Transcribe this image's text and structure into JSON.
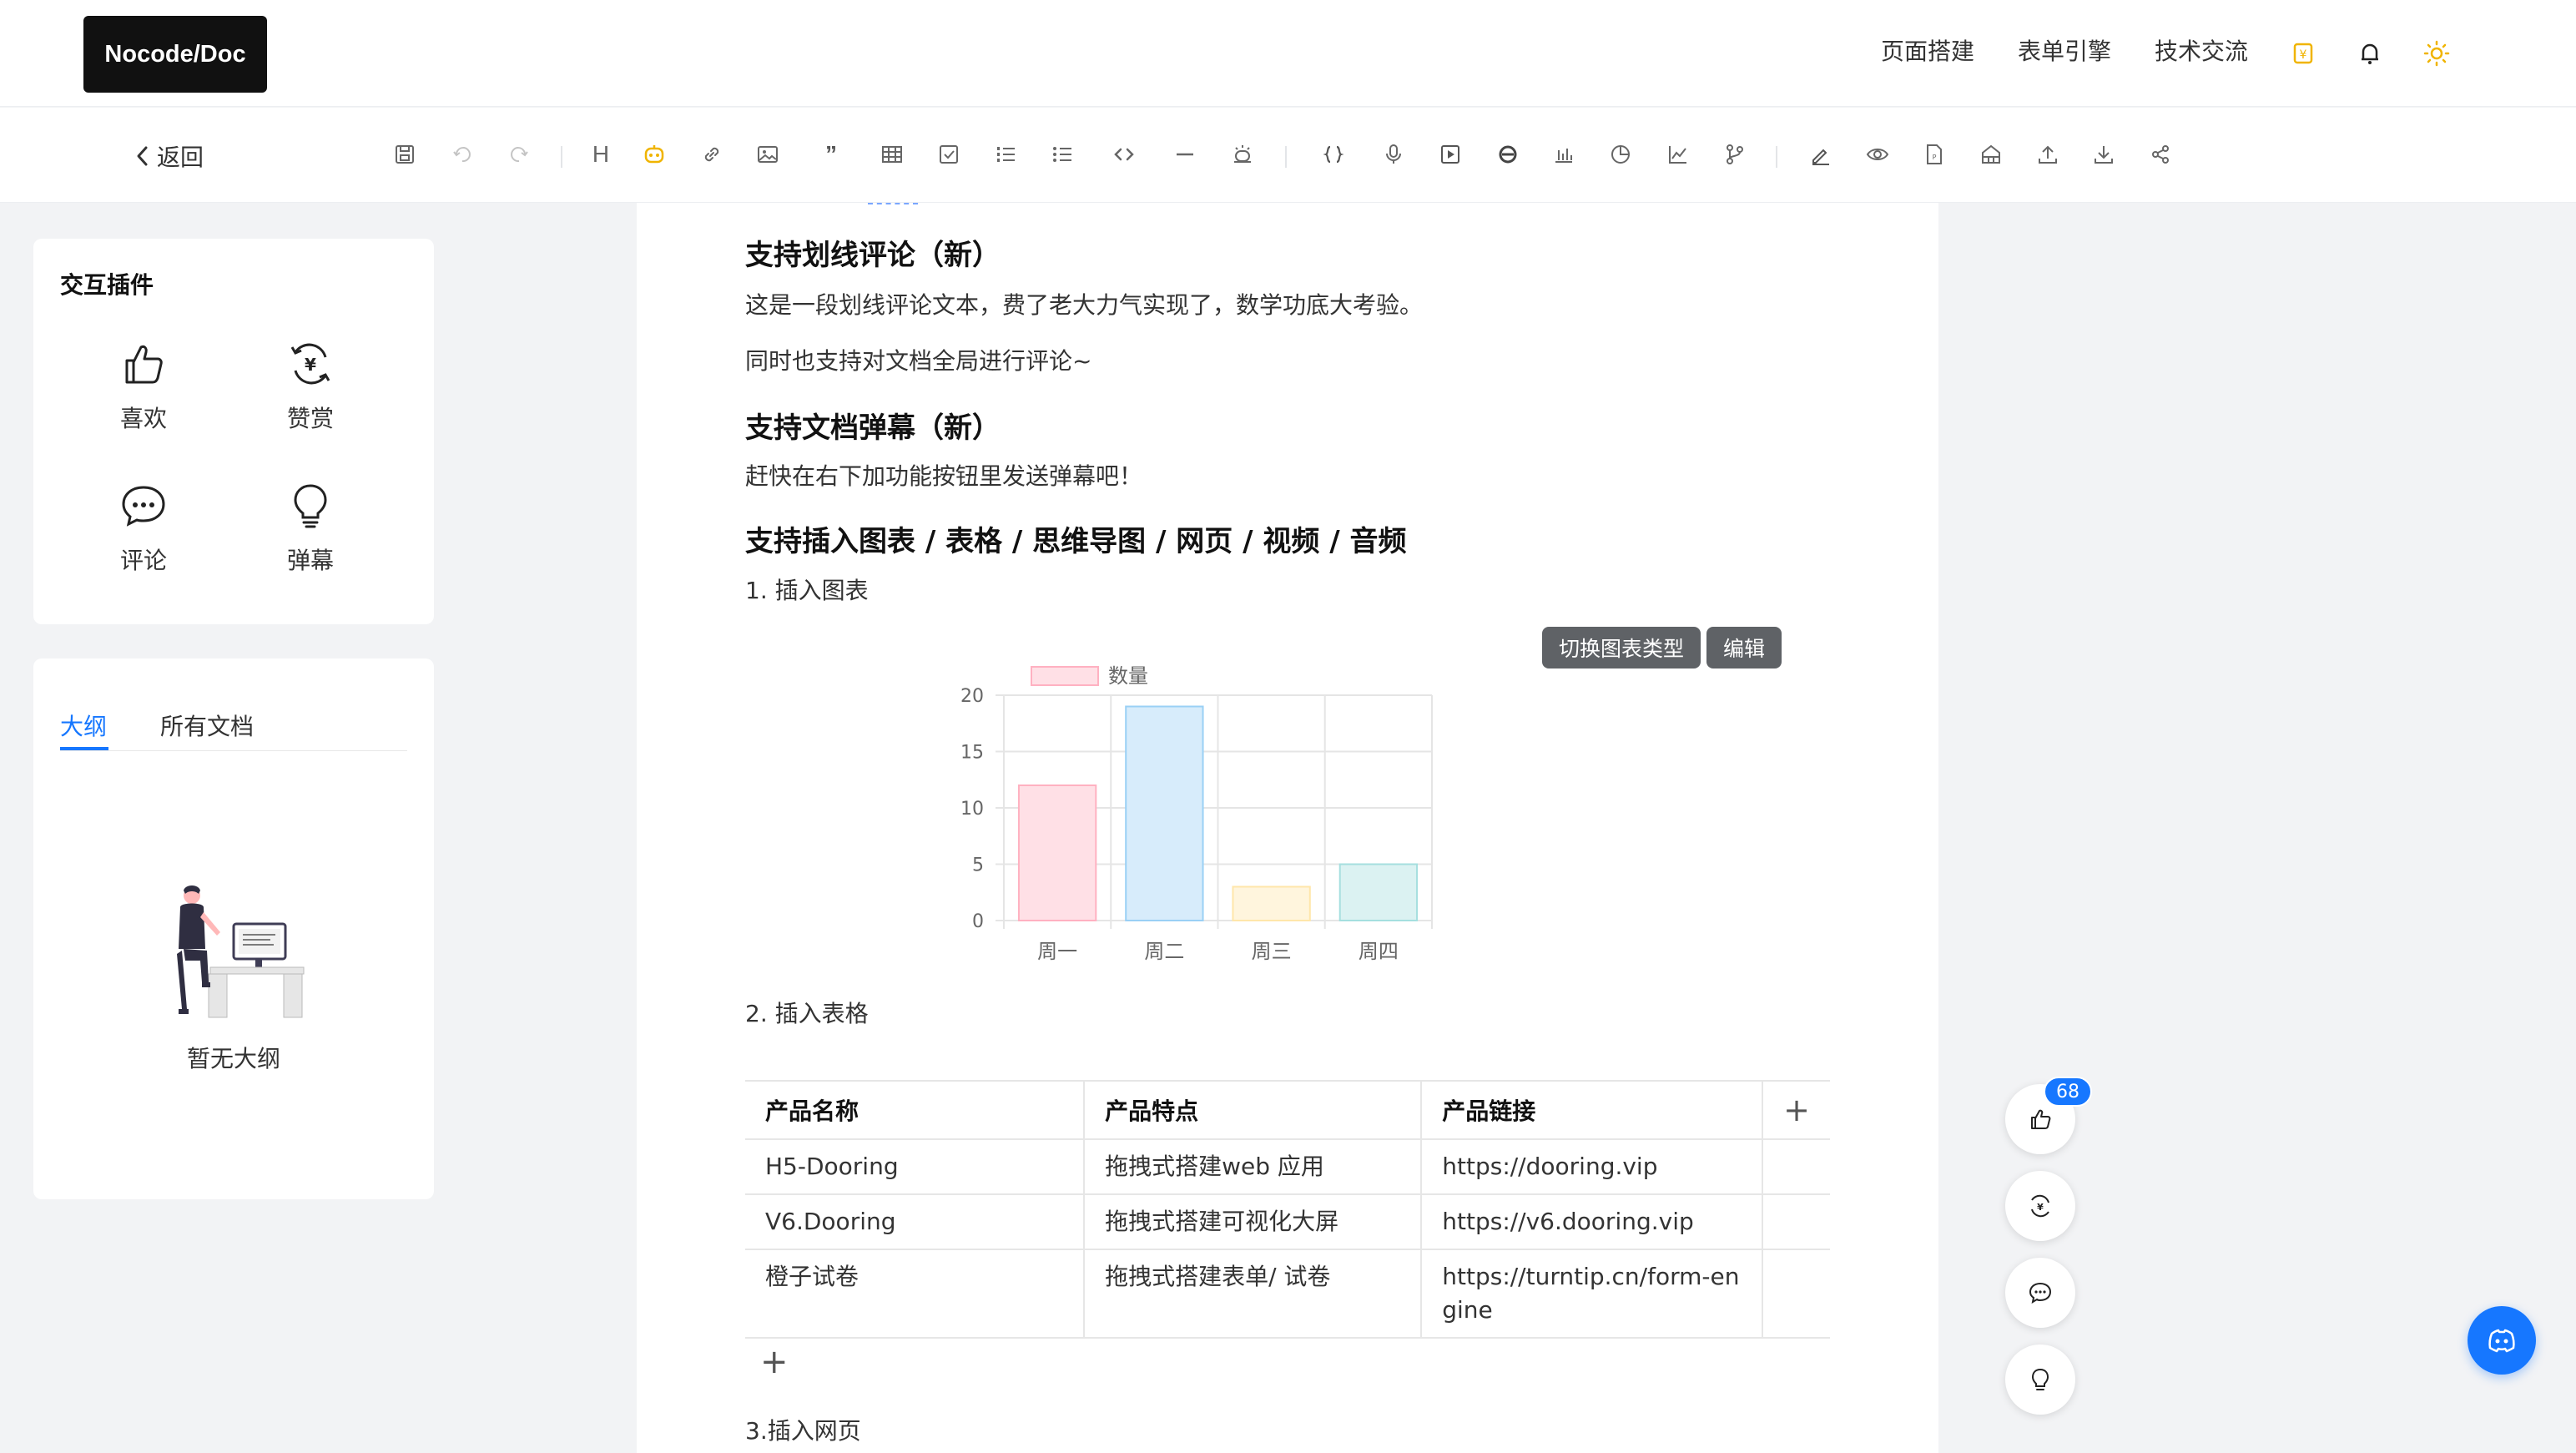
{
  "header": {
    "logo": "Nocode/Doc",
    "nav": [
      "页面搭建",
      "表单引擎",
      "技术交流"
    ],
    "icons": [
      "coin-icon",
      "bell-icon",
      "sun-icon"
    ]
  },
  "toolbar": {
    "back_label": "返回",
    "heading_glyph": "H",
    "icons": [
      "save-icon",
      "undo-icon",
      "redo-icon",
      "heading-icon",
      "ai-bot-icon",
      "link-icon",
      "image-icon",
      "quote-icon",
      "table-icon",
      "checkbox-icon",
      "ordered-list-icon",
      "bullet-list-icon",
      "code-icon",
      "divider-icon",
      "alarm-icon",
      "braces-icon",
      "microphone-icon",
      "video-icon",
      "webpage-icon",
      "bar-chart-icon",
      "pie-chart-icon",
      "line-chart-icon",
      "branch-icon",
      "sign-icon",
      "preview-icon",
      "pdf-icon",
      "house-icon",
      "upload-icon",
      "download-icon",
      "share-icon"
    ]
  },
  "plugins_panel": {
    "title": "交互插件",
    "items": [
      {
        "label": "喜欢",
        "icon": "thumbs-up-icon"
      },
      {
        "label": "赞赏",
        "icon": "yen-coin-icon"
      },
      {
        "label": "评论",
        "icon": "comment-icon"
      },
      {
        "label": "弹幕",
        "icon": "lightbulb-icon"
      }
    ]
  },
  "outline_panel": {
    "tabs": [
      "大纲",
      "所有文档"
    ],
    "active_tab": "大纲",
    "empty_text": "暂无大纲"
  },
  "document": {
    "section1_title": "支持划线评论（新）",
    "section1_p1": "这是一段划线评论文本，费了老大力气实现了，数学功底大考验。",
    "section1_p2": "同时也支持对文档全局进行评论~",
    "section2_title": "支持文档弹幕（新）",
    "section2_p1": "赶快在右下加功能按钮里发送弹幕吧！",
    "section3_title": "支持插入图表 / 表格 / 思维导图 / 网页 / 视频 / 音频",
    "item1": "1. 插入图表",
    "chart_buttons": [
      "切换图表类型",
      "编辑"
    ],
    "item2": "2. 插入表格",
    "item3": "3.插入网页",
    "table": {
      "headers": [
        "产品名称",
        "产品特点",
        "产品链接"
      ],
      "rows": [
        [
          "H5-Dooring",
          "拖拽式搭建web 应用",
          "https://dooring.vip"
        ],
        [
          "V6.Dooring",
          "拖拽式搭建可视化大屏",
          "https://v6.dooring.vip"
        ],
        [
          "橙子试卷",
          "拖拽式搭建表单/ 试卷",
          "https://turntip.cn/form-engine"
        ]
      ],
      "add_column": "+",
      "add_row": "+"
    }
  },
  "chart_data": {
    "type": "bar",
    "categories": [
      "周一",
      "周二",
      "周三",
      "周四"
    ],
    "series": [
      {
        "name": "数量",
        "values": [
          12,
          19,
          3,
          5
        ]
      }
    ],
    "ylim": [
      0,
      20
    ],
    "yticks": [
      0,
      5,
      10,
      15,
      20
    ],
    "colors": [
      "#ffe0e6",
      "#d7ecfb",
      "#fff5dd",
      "#dbf2f2"
    ],
    "borders": [
      "#ffb1c1",
      "#9ad0f5",
      "#ffe6aa",
      "#a5dfdf"
    ],
    "legend": "top",
    "grid": true
  },
  "floating": {
    "like_count": "68",
    "buttons": [
      "thumbs-up-icon",
      "yen-coin-icon",
      "comment-icon",
      "lightbulb-icon"
    ]
  }
}
